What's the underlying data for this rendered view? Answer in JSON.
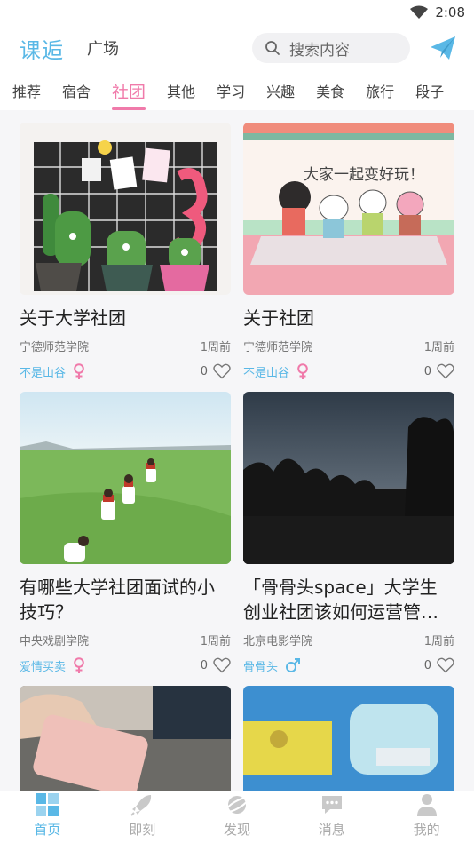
{
  "status": {
    "time": "2:08"
  },
  "header": {
    "brand": "课逅",
    "plaza": "广场",
    "search_placeholder": "搜索内容"
  },
  "tabs": [
    "推荐",
    "宿舍",
    "社团",
    "其他",
    "学习",
    "兴趣",
    "美食",
    "旅行",
    "段子"
  ],
  "active_tab": "社团",
  "cards": [
    {
      "title": "关于大学社团",
      "school": "宁德师范学院",
      "time": "1周前",
      "author": "不是山谷",
      "gender": "female",
      "likes": "0"
    },
    {
      "title": "关于社团",
      "school": "宁德师范学院",
      "time": "1周前",
      "author": "不是山谷",
      "gender": "female",
      "likes": "0",
      "image_text": "大家一起变好玩！"
    },
    {
      "title": "有哪些大学社团面试的小技巧？",
      "school": "中央戏剧学院",
      "time": "1周前",
      "author": "爱情买卖",
      "gender": "female",
      "likes": "0"
    },
    {
      "title": "「骨骨头space」大学生创业社团该如何运营管…",
      "school": "北京电影学院",
      "time": "1周前",
      "author": "骨骨头",
      "gender": "male",
      "likes": "0"
    }
  ],
  "bottom_nav": [
    {
      "label": "首页",
      "icon": "home-grid-icon",
      "active": true
    },
    {
      "label": "即刻",
      "icon": "rocket-icon",
      "active": false
    },
    {
      "label": "发现",
      "icon": "planet-icon",
      "active": false
    },
    {
      "label": "消息",
      "icon": "chat-bubble-icon",
      "active": false
    },
    {
      "label": "我的",
      "icon": "person-icon",
      "active": false
    }
  ],
  "colors": {
    "accent_blue": "#5ab8e6",
    "accent_pink": "#f07aaa",
    "male_blue": "#5ab8e6",
    "female_pink": "#f07aaa"
  }
}
